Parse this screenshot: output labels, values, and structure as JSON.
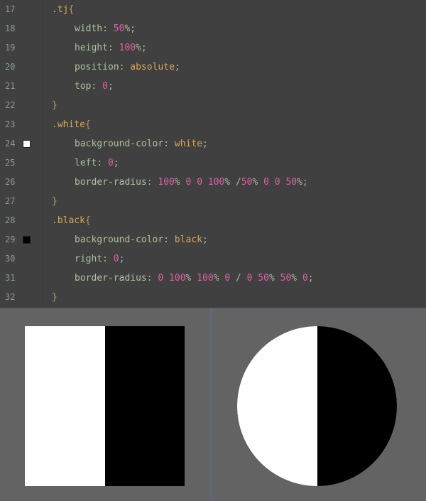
{
  "editor": {
    "lines": [
      {
        "num": "17",
        "parts": [
          {
            "t": ".tj",
            "c": "sel"
          },
          {
            "t": "{",
            "c": "brace"
          }
        ],
        "indent": false
      },
      {
        "num": "18",
        "parts": [
          {
            "t": "width",
            "c": "prop"
          },
          {
            "t": ": ",
            "c": "punc"
          },
          {
            "t": "50",
            "c": "val-num"
          },
          {
            "t": "%;",
            "c": "punc"
          }
        ],
        "indent": true
      },
      {
        "num": "19",
        "parts": [
          {
            "t": "height",
            "c": "prop"
          },
          {
            "t": ": ",
            "c": "punc"
          },
          {
            "t": "100",
            "c": "val-num"
          },
          {
            "t": "%;",
            "c": "punc"
          }
        ],
        "indent": true
      },
      {
        "num": "20",
        "parts": [
          {
            "t": "position",
            "c": "prop"
          },
          {
            "t": ": ",
            "c": "punc"
          },
          {
            "t": "absolute",
            "c": "val-kw"
          },
          {
            "t": ";",
            "c": "punc"
          }
        ],
        "indent": true
      },
      {
        "num": "21",
        "parts": [
          {
            "t": "top",
            "c": "prop"
          },
          {
            "t": ": ",
            "c": "punc"
          },
          {
            "t": "0",
            "c": "val-num"
          },
          {
            "t": ";",
            "c": "punc"
          }
        ],
        "indent": true
      },
      {
        "num": "22",
        "parts": [
          {
            "t": "}",
            "c": "brace"
          }
        ],
        "indent": false
      },
      {
        "num": "23",
        "parts": [
          {
            "t": ".white",
            "c": "sel"
          },
          {
            "t": "{",
            "c": "brace"
          }
        ],
        "indent": false
      },
      {
        "num": "24",
        "parts": [
          {
            "t": "background-color",
            "c": "prop"
          },
          {
            "t": ": ",
            "c": "punc"
          },
          {
            "t": "white",
            "c": "val-kw"
          },
          {
            "t": ";",
            "c": "punc"
          }
        ],
        "indent": true,
        "swatch": "#ffffff"
      },
      {
        "num": "25",
        "parts": [
          {
            "t": "left",
            "c": "prop"
          },
          {
            "t": ": ",
            "c": "punc"
          },
          {
            "t": "0",
            "c": "val-num"
          },
          {
            "t": ";",
            "c": "punc"
          }
        ],
        "indent": true
      },
      {
        "num": "26",
        "parts": [
          {
            "t": "border-radius",
            "c": "prop"
          },
          {
            "t": ": ",
            "c": "punc"
          },
          {
            "t": "100",
            "c": "val-num"
          },
          {
            "t": "% ",
            "c": "punc"
          },
          {
            "t": "0 0 100",
            "c": "val-num"
          },
          {
            "t": "% /",
            "c": "punc"
          },
          {
            "t": "50",
            "c": "val-num"
          },
          {
            "t": "% ",
            "c": "punc"
          },
          {
            "t": "0 0 50",
            "c": "val-num"
          },
          {
            "t": "%;",
            "c": "punc"
          }
        ],
        "indent": true
      },
      {
        "num": "27",
        "parts": [
          {
            "t": "}",
            "c": "brace"
          }
        ],
        "indent": false
      },
      {
        "num": "28",
        "parts": [
          {
            "t": ".black",
            "c": "sel"
          },
          {
            "t": "{",
            "c": "brace"
          }
        ],
        "indent": false
      },
      {
        "num": "29",
        "parts": [
          {
            "t": "background-color",
            "c": "prop"
          },
          {
            "t": ": ",
            "c": "punc"
          },
          {
            "t": "black",
            "c": "val-kw"
          },
          {
            "t": ";",
            "c": "punc"
          }
        ],
        "indent": true,
        "swatch": "#000000"
      },
      {
        "num": "30",
        "parts": [
          {
            "t": "right",
            "c": "prop"
          },
          {
            "t": ": ",
            "c": "punc"
          },
          {
            "t": "0",
            "c": "val-num"
          },
          {
            "t": ";",
            "c": "punc"
          }
        ],
        "indent": true
      },
      {
        "num": "31",
        "parts": [
          {
            "t": "border-radius",
            "c": "prop"
          },
          {
            "t": ": ",
            "c": "punc"
          },
          {
            "t": "0 100",
            "c": "val-num"
          },
          {
            "t": "% ",
            "c": "punc"
          },
          {
            "t": "100",
            "c": "val-num"
          },
          {
            "t": "% ",
            "c": "punc"
          },
          {
            "t": "0",
            "c": "val-num"
          },
          {
            "t": " / ",
            "c": "punc"
          },
          {
            "t": "0 50",
            "c": "val-num"
          },
          {
            "t": "% ",
            "c": "punc"
          },
          {
            "t": "50",
            "c": "val-num"
          },
          {
            "t": "% ",
            "c": "punc"
          },
          {
            "t": "0",
            "c": "val-num"
          },
          {
            "t": ";",
            "c": "punc"
          }
        ],
        "indent": true
      },
      {
        "num": "32",
        "parts": [
          {
            "t": "}",
            "c": "brace"
          }
        ],
        "indent": false
      }
    ]
  },
  "colors": {
    "editor_bg": "#404040",
    "preview_bg": "#636363",
    "selector": "#d8a654",
    "property": "#a9c49a",
    "number": "#e05fa8",
    "keyword": "#d8a654"
  }
}
